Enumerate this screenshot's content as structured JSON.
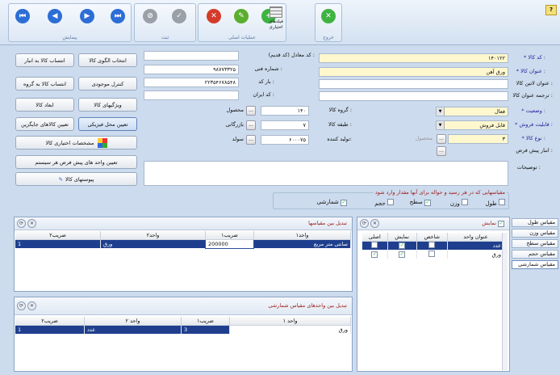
{
  "toolbar": {
    "groups": {
      "navigation": "پیمایش",
      "record": "ثبت",
      "main_ops": "عملیات اصلی"
    },
    "big_buttons": {
      "custom_fields": "فیلدهای اختیاری",
      "exit": "خروج"
    },
    "help": "?"
  },
  "side_buttons": {
    "select_pattern": "انتخاب الگوی کالا",
    "assign_to_store": "انتساب کالا به انبار",
    "inventory_control": "کنترل موجودی",
    "assign_to_group": "انتساب کالا به گروه",
    "features": "ویژگیهای کالا",
    "dimensions": "ابعاد کالا",
    "physical_location": "تعیین محل فیزیکی",
    "substitutes": "تعیین کالاهای جایگزین",
    "custom_specs": "مشخصات اختیاری کالا",
    "default_units": "تعیین واحد های پیش فرض هر سیستم",
    "attachments": "پیوستهای کالا"
  },
  "form": {
    "code_label": "* کد کالا :",
    "code_value": "۱۴۰۱۲۲",
    "title_label": "* عنوان کالا :",
    "title_value": "ورق آهن",
    "latin_label": "عنوان لاتین کالا :",
    "latin_value": "",
    "translate_label": "ترجمه عنوان کالا :",
    "translate_value": "",
    "status_label": "* وضعیت :",
    "status_value": "فعال",
    "salability_label": "* قابلیت فروش :",
    "salability_value": "قابل فروش",
    "type_label": "* نوع کالا :",
    "type_value": "۳",
    "type_product_label": "محصول",
    "default_store_label": "انبار پیش فرض :",
    "desc_label": "توضیحات :",
    "equiv_label": "کد معادل (کد قدیم) :",
    "equiv_value": "",
    "tech_no_label": "شماره فنی :",
    "tech_no_value": "۹۸۷۷۳۳۲۵",
    "barcode_label": "بار کد :",
    "barcode_value": "۲۲۳۵۴۶۷۸۵۴۸",
    "iran_code_label": "کد ایران :",
    "iran_code_value": "",
    "group_label": "گروه کالا :",
    "group_value": "۱۴۰",
    "group_name": "محصول",
    "class_label": "طبقه کالا :",
    "class_value": "۷",
    "class_name": "بازرگانی",
    "producer_label": "تولید کننده:",
    "producer_value": "۶۰۰۰۷۵",
    "producer_name": "سولد"
  },
  "measures": {
    "caption": "مقیاسهایی که در هر رسید و حواله برای آنها مقدار وارد شود",
    "items": [
      {
        "label": "طول",
        "checked": false
      },
      {
        "label": "وزن",
        "checked": false
      },
      {
        "label": "سطح",
        "checked": true
      },
      {
        "label": "حجم",
        "checked": false
      },
      {
        "label": "شمارشی",
        "checked": true
      }
    ]
  },
  "tabs": [
    "مقیاس طول",
    "مقیاس وزن",
    "مقیاس سطح",
    "مقیاس حجم",
    "مقیاس شمارشی"
  ],
  "units_panel": {
    "title": "نمایش",
    "headers": [
      "عنوان واحد",
      "شاخص",
      "نمایش",
      "اصلی"
    ],
    "rows": [
      {
        "unit": "عدد",
        "index": false,
        "show": true,
        "main": false
      },
      {
        "unit": "ورق",
        "index": false,
        "show": true,
        "main": true
      }
    ]
  },
  "conv_panel": {
    "title": "تبدیل بین مقیاسها",
    "headers": [
      "واحد۱",
      "ضریب۱",
      "واحد۲",
      "ضریب۲"
    ],
    "rows": [
      {
        "u1": "سانتی متر مربع",
        "f1": "200000",
        "u2": "ورق",
        "f2": "1"
      }
    ]
  },
  "count_panel": {
    "title": "تبدیل بین واحدهای مقیاس شمارشی",
    "headers": [
      "واحد ۱",
      "ضریب۱",
      "واحد ۲",
      "ضریب۲"
    ],
    "rows": [
      {
        "u1": "ورق",
        "f1": "3",
        "u2": "عدد",
        "f2": "1"
      }
    ]
  }
}
